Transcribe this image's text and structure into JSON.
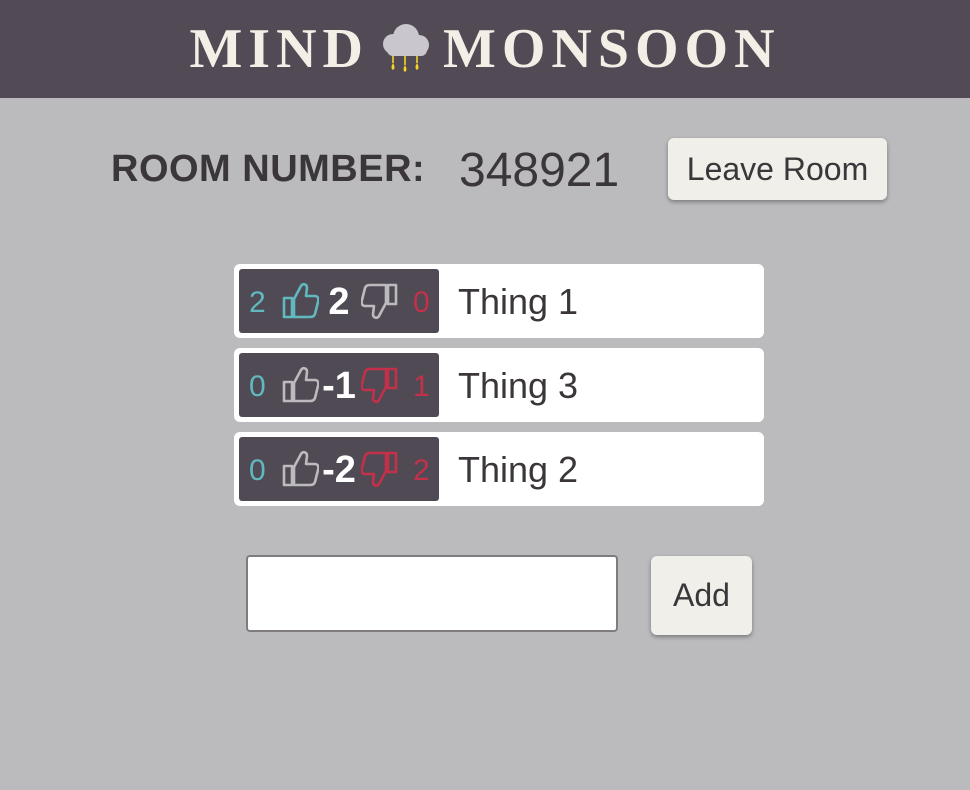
{
  "header": {
    "logo_left": "MIND",
    "logo_right": "MONSOON",
    "logo_icon": "rain-cloud-icon",
    "background_color": "#524a54"
  },
  "room": {
    "label": "ROOM NUMBER:",
    "number": "348921",
    "leave_label": "Leave Room"
  },
  "items": [
    {
      "up": "2",
      "score": "2",
      "down": "0",
      "text": "Thing 1",
      "up_active": true,
      "down_active": false
    },
    {
      "up": "0",
      "score": "-1",
      "down": "1",
      "text": "Thing 3",
      "up_active": false,
      "down_active": true
    },
    {
      "up": "0",
      "score": "-2",
      "down": "2",
      "text": "Thing 2",
      "up_active": false,
      "down_active": true
    }
  ],
  "new_item": {
    "value": "",
    "add_label": "Add"
  },
  "colors": {
    "page_background": "#bbbbbd",
    "vote_box": "#504a54",
    "upvote": "#5fb9bf",
    "downvote": "#c4304a",
    "inactive_thumb": "#bdbabd",
    "button": "#f1efea"
  }
}
